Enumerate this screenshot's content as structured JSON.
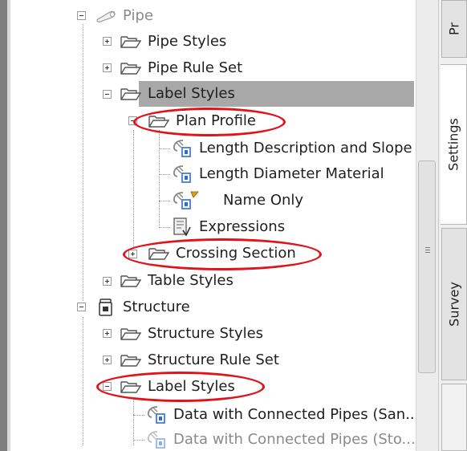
{
  "tree": {
    "items": [
      {
        "label": "Pipe",
        "icon": "pipe-icon"
      },
      {
        "label": "Pipe Styles",
        "icon": "folder-icon"
      },
      {
        "label": "Pipe Rule Set",
        "icon": "folder-icon"
      },
      {
        "label": "Label Styles",
        "icon": "folder-icon"
      },
      {
        "label": "Plan Profile",
        "icon": "folder-icon"
      },
      {
        "label": "Length Description and Slope",
        "icon": "label-style-icon"
      },
      {
        "label": "Length Diameter Material",
        "icon": "label-style-icon"
      },
      {
        "label": "Name Only",
        "icon": "label-style-icon"
      },
      {
        "label": "Expressions",
        "icon": "expressions-icon"
      },
      {
        "label": "Crossing Section",
        "icon": "folder-icon"
      },
      {
        "label": "Table Styles",
        "icon": "folder-icon"
      },
      {
        "label": "Structure",
        "icon": "structure-icon"
      },
      {
        "label": "Structure Styles",
        "icon": "folder-icon"
      },
      {
        "label": "Structure Rule Set",
        "icon": "folder-icon"
      },
      {
        "label": "Label Styles",
        "icon": "folder-icon"
      },
      {
        "label": "Data with Connected Pipes (San...",
        "icon": "label-style-icon"
      },
      {
        "label": "Data with Connected Pipes (Sto...",
        "icon": "label-style-icon"
      }
    ]
  },
  "tabs": [
    {
      "label": "Pr"
    },
    {
      "label": "Settings"
    },
    {
      "label": "Survey"
    }
  ],
  "colors": {
    "selected": "#a8a8a8",
    "highlight_ellipse": "#e2121a",
    "folder": "#555555",
    "label_style_blue": "#2d6fc4",
    "flag": "#e0a020"
  }
}
